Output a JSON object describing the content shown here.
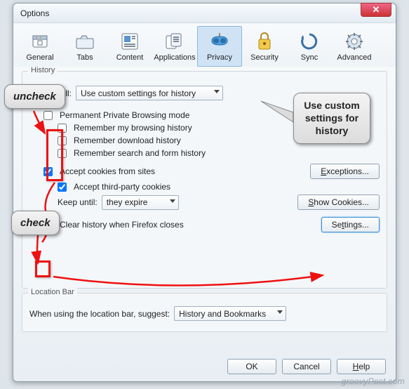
{
  "window": {
    "title": "Options"
  },
  "tabs": [
    {
      "label": "General"
    },
    {
      "label": "Tabs"
    },
    {
      "label": "Content"
    },
    {
      "label": "Applications"
    },
    {
      "label": "Privacy"
    },
    {
      "label": "Security"
    },
    {
      "label": "Sync"
    },
    {
      "label": "Advanced"
    }
  ],
  "history": {
    "legend": "History",
    "firefox_will_label": "Firefox will:",
    "firefox_will_value": "Use custom settings for history",
    "permanent_private": "Permanent Private Browsing mode",
    "remember_browsing": "Remember my browsing history",
    "remember_download": "Remember download history",
    "remember_forms": "Remember search and form history",
    "accept_cookies": "Accept cookies from sites",
    "accept_third_party": "Accept third-party cookies",
    "keep_until_label": "Keep until:",
    "keep_until_value": "they expire",
    "clear_on_close": "Clear history when Firefox closes",
    "exceptions_btn": "Exceptions...",
    "show_cookies_btn": "Show Cookies...",
    "settings_btn": "Settings..."
  },
  "locationbar": {
    "legend": "Location Bar",
    "suggest_label": "When using the location bar, suggest:",
    "suggest_value": "History and Bookmarks"
  },
  "buttons": {
    "ok": "OK",
    "cancel": "Cancel",
    "help": "Help"
  },
  "annotations": {
    "uncheck": "uncheck",
    "check": "check",
    "custom": "Use custom settings for history"
  },
  "watermark": "groovyPost.com"
}
